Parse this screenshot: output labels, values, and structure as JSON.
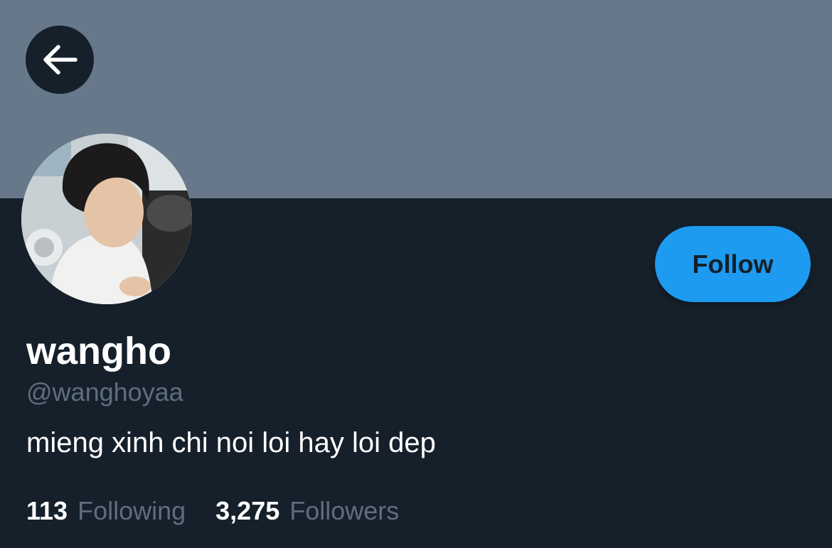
{
  "header": {
    "back_icon": "arrow-left-icon"
  },
  "profile": {
    "avatar_icon": "profile-photo",
    "display_name": "wangho",
    "handle": "@wanghoyaa",
    "bio": "mieng xinh chi noi loi hay loi dep",
    "follow_label": "Follow"
  },
  "stats": {
    "following_count": "113",
    "following_label": "Following",
    "followers_count": "3,275",
    "followers_label": "Followers"
  },
  "colors": {
    "banner": "#66788a",
    "background": "#15202b",
    "accent": "#1d9bf0",
    "secondary_text": "#5e6e7d"
  }
}
